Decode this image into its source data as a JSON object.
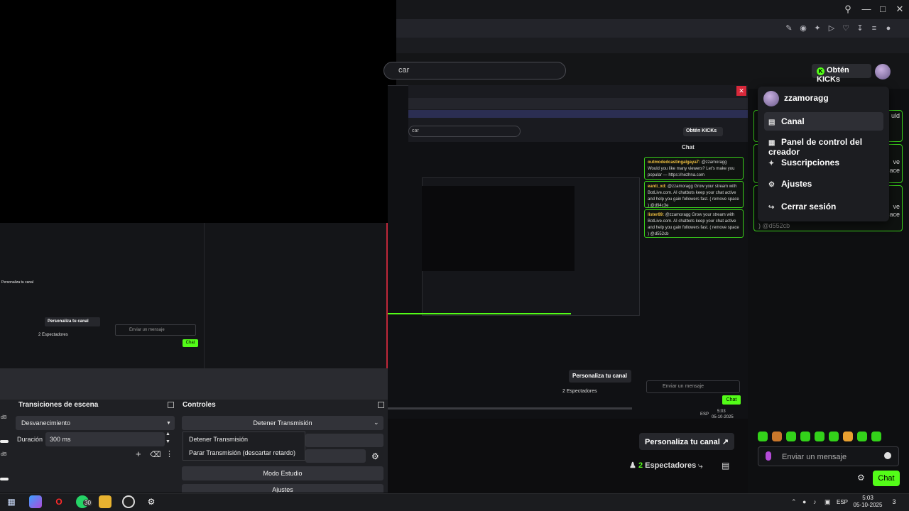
{
  "browser": {
    "search_placeholder": "car",
    "kicks_label": "Obtén KICKs",
    "toolbar_icons": [
      "edit-icon",
      "camera-icon",
      "extension-icon",
      "play-icon",
      "heart-icon",
      "download-icon",
      "menu-icon",
      "profile-icon"
    ]
  },
  "user_menu": {
    "username": "zzamoragg",
    "items": [
      {
        "label": "Canal",
        "icon": "channel-icon"
      },
      {
        "label": "Panel de control del creador",
        "icon": "dashboard-icon"
      },
      {
        "label": "Suscripciones",
        "icon": "subscriptions-icon"
      },
      {
        "label": "Ajustes",
        "icon": "gear-icon"
      },
      {
        "label": "Cerrar sesión",
        "icon": "logout-icon"
      }
    ]
  },
  "chat": {
    "partial_texts": [
      "uld",
      "ve",
      "ace",
      "ve",
      "ace",
      ") @d552cb"
    ],
    "input_placeholder": "Enviar un mensaje",
    "send_label": "Chat",
    "personaliza_label": "Personaliza tu canal",
    "viewers_count": "2",
    "viewers_label": "Espectadores"
  },
  "nested": {
    "search_text": "car",
    "kicks_label": "Obtén KICKs",
    "chat_title": "Chat",
    "messages": [
      {
        "user": "outmodedcastingalgaya7:",
        "text": "@zzamoragg Would you like many viewers? Let's make you popular — https://nezhna.com"
      },
      {
        "user": "eanti_xd:",
        "text": "@zzamoragg Grow your stream with BotLive.com. AI chatbots keep your chat active and help you gain followers fast. ( remove space ) @d94c3e"
      },
      {
        "user": "lister69:",
        "text": "@zzamoragg Grow your stream with BotLive.com. AI chatbots keep your chat active and help you gain followers fast. ( remove space ) @d552cb"
      }
    ],
    "personaliza_label": "Personaliza tu canal",
    "viewers_label": "2 Espectadores",
    "input_placeholder": "Enviar un mensaje",
    "send_label": "Chat",
    "tray_lang": "ESP",
    "tray_time": "5:03",
    "tray_date": "05-10-2025"
  },
  "obs": {
    "mini_personaliza": "Personaliza tu canal",
    "mini_personaliza_small": "Personaliza tu canal",
    "mini_viewers": "2 Espectadores",
    "mini_input": "Enviar un mensaje",
    "mini_chat": "Chat",
    "db_labels": [
      "dB",
      "dB"
    ],
    "transitions": {
      "title": "Transiciones de escena",
      "selected": "Desvanecimiento",
      "duration_label": "Duración",
      "duration_value": "300 ms"
    },
    "controls": {
      "title": "Controles",
      "main_button": "Detener Transmisión",
      "popup_items": [
        "Detener Transmisión",
        "Parar Transmisión (descartar retardo)"
      ],
      "studio_button": "Modo Estudio",
      "settings_button": "Ajustes"
    }
  },
  "taskbar": {
    "apps": [
      "windows-start-icon",
      "copilot-icon",
      "opera-icon",
      "whatsapp-icon",
      "file-explorer-icon",
      "obs-icon",
      "settings-icon"
    ],
    "whatsapp_badge": "30",
    "lang": "ESP",
    "time": "5:03",
    "date": "05-10-2025",
    "notif_count": "3"
  }
}
